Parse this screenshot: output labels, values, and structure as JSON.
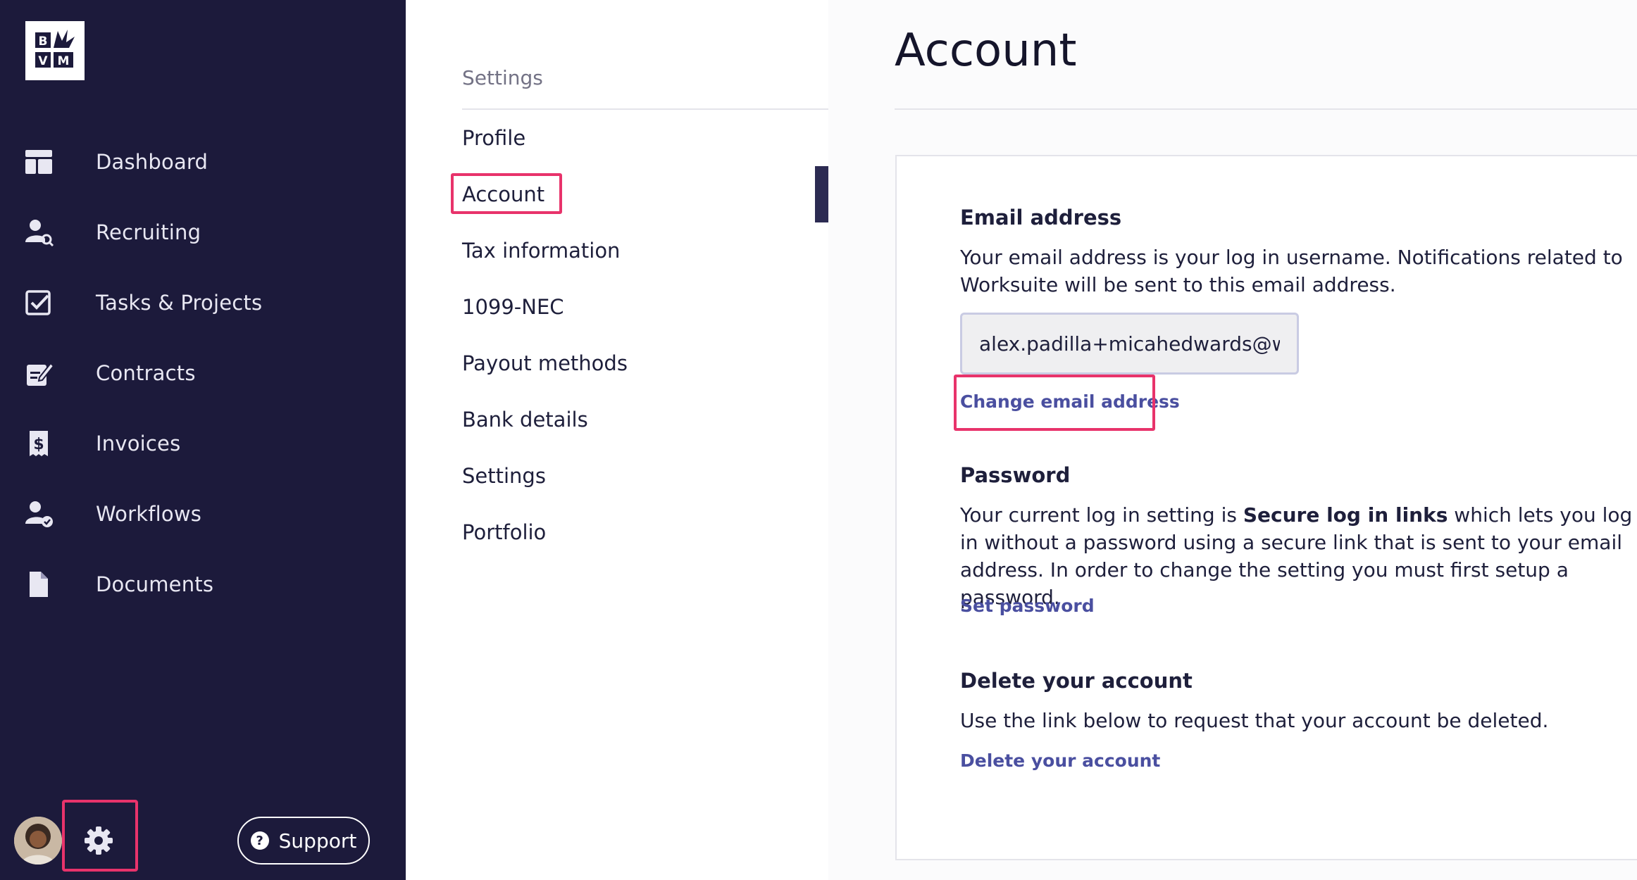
{
  "logo": {
    "text_top": "B",
    "text_bottom_left": "V",
    "text_bottom_right": "M"
  },
  "sidebar": {
    "items": [
      {
        "label": "Dashboard",
        "icon": "dashboard-icon"
      },
      {
        "label": "Recruiting",
        "icon": "recruiting-icon"
      },
      {
        "label": "Tasks & Projects",
        "icon": "tasks-icon"
      },
      {
        "label": "Contracts",
        "icon": "contracts-icon"
      },
      {
        "label": "Invoices",
        "icon": "invoices-icon"
      },
      {
        "label": "Workflows",
        "icon": "workflows-icon"
      },
      {
        "label": "Documents",
        "icon": "documents-icon"
      }
    ],
    "support_label": "Support"
  },
  "settings_nav": {
    "title": "Settings",
    "items": [
      {
        "label": "Profile"
      },
      {
        "label": "Account"
      },
      {
        "label": "Tax information"
      },
      {
        "label": "1099-NEC"
      },
      {
        "label": "Payout methods"
      },
      {
        "label": "Bank details"
      },
      {
        "label": "Settings"
      },
      {
        "label": "Portfolio"
      }
    ],
    "active": "Account"
  },
  "main": {
    "title": "Account",
    "email": {
      "heading": "Email address",
      "description": "Your email address is your log in username. Notifications related to Worksuite will be sent to this email address.",
      "value": "alex.padilla+micahedwards@wor",
      "change_link": "Change email address"
    },
    "password": {
      "heading": "Password",
      "text_before": "Your current log in setting is ",
      "text_bold": "Secure log in links",
      "text_after": " which lets you log in without a password using a secure link that is sent to your email address. In order to change the setting you must first setup a password.",
      "link": "Set password"
    },
    "delete": {
      "heading": "Delete your account",
      "description": "Use the link below to request that your account be deleted.",
      "link": "Delete your account"
    }
  },
  "colors": {
    "sidebar_bg": "#1c1a3b",
    "highlight": "#e8336b",
    "link": "#4a4fa0"
  }
}
